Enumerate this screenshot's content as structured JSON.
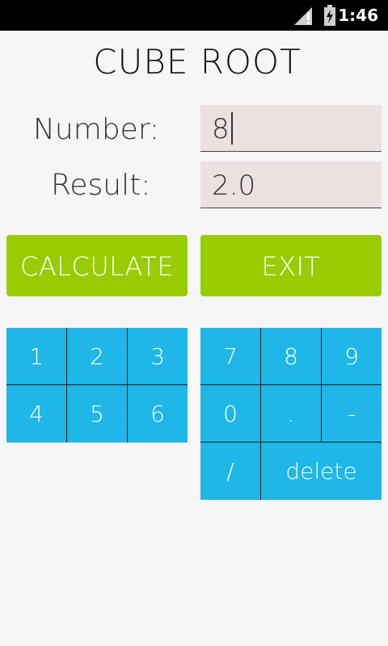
{
  "status": {
    "time": "1:46"
  },
  "title": "CUBE ROOT",
  "number_label": "Number:",
  "number_value": "8",
  "result_label": "Result:",
  "result_value": "2.0",
  "buttons": {
    "calculate": "CALCULATE",
    "exit": "EXIT"
  },
  "keypad_left": [
    "1",
    "2",
    "3",
    "4",
    "5",
    "6"
  ],
  "keypad_right": [
    "7",
    "8",
    "9",
    "0",
    ".",
    "-",
    "/",
    "delete"
  ],
  "colors": {
    "accent": "#99cc00",
    "keys": "#1fb6e8",
    "field": "#ebe1e1"
  }
}
